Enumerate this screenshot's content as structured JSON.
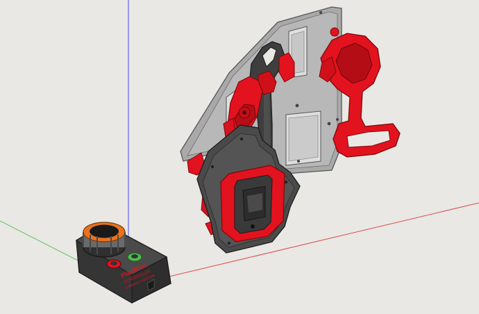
{
  "viewport": {
    "background": "#e9e8e4",
    "model_color_red": "#e3121f",
    "model_color_dark": "#3f3f3f",
    "model_color_grey": "#9d9d9d"
  },
  "controller_label": {
    "line1": "FlaxWorx",
    "line2": "CONTROLLER",
    "line3": "COMPACT EDITION"
  }
}
